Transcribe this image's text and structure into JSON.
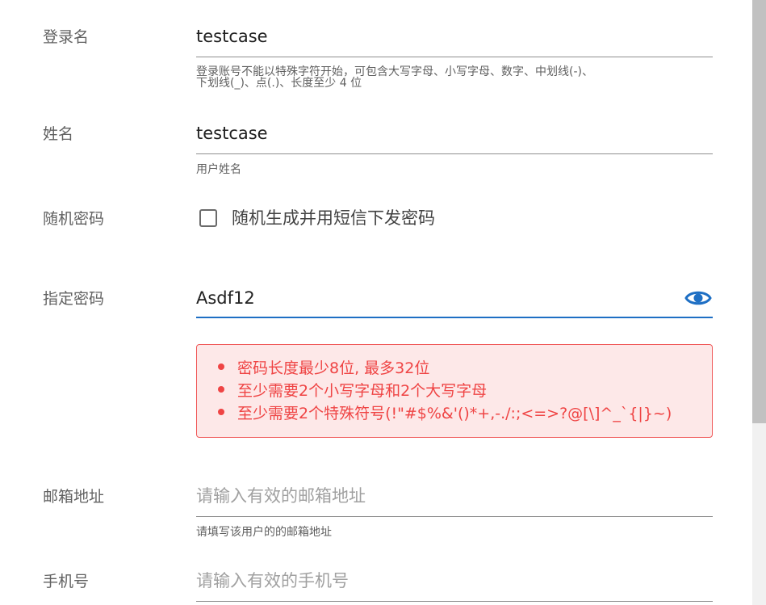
{
  "form": {
    "login_name": {
      "label": "登录名",
      "value": "testcase",
      "hint_line1": "登录账号不能以特殊字符开始，可包含大写字母、小写字母、数字、中划线(-)、",
      "hint_line2": "下划线(_)、点(.)、长度至少 4 位"
    },
    "full_name": {
      "label": "姓名",
      "value": "testcase",
      "hint": "用户姓名"
    },
    "random_password": {
      "label": "随机密码",
      "checkbox_label": "随机生成并用短信下发密码",
      "checked": false
    },
    "assigned_password": {
      "label": "指定密码",
      "value": "Asdf12",
      "errors": [
        "密码长度最少8位, 最多32位",
        "至少需要2个小写字母和2个大写字母",
        "至少需要2个特殊符号(!\"#$%&'()*+,-./:;<=>?@[\\]^_`{|}~)"
      ]
    },
    "email": {
      "label": "邮箱地址",
      "placeholder": "请输入有效的邮箱地址",
      "hint": "请填写该用户的的邮箱地址"
    },
    "phone": {
      "label": "手机号",
      "placeholder": "请输入有效的手机号"
    }
  },
  "icons": {
    "password_toggle": "eye-icon"
  },
  "colors": {
    "accent": "#1e6fc4",
    "error_text": "#ef4444",
    "error_bg": "#fde8e8",
    "error_border": "#f05a5a"
  }
}
